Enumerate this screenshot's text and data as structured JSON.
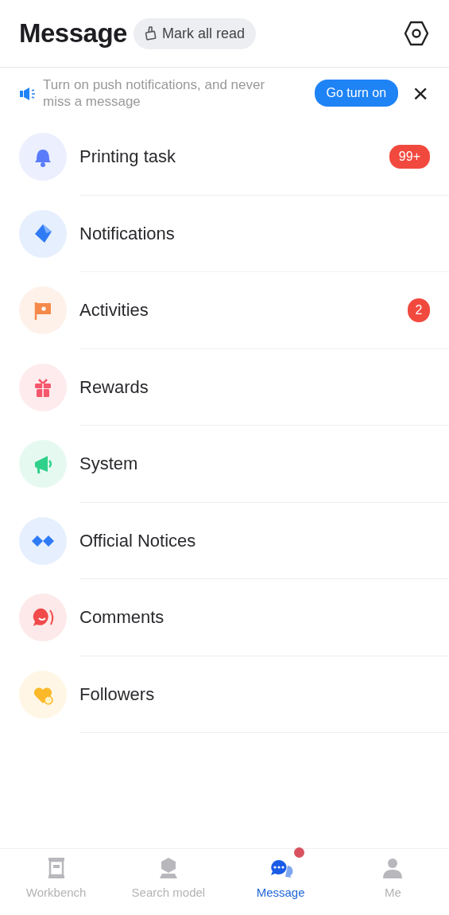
{
  "header": {
    "title": "Message",
    "mark_all_read": "Mark all read"
  },
  "banner": {
    "text": "Turn on push notifications, and never miss a message",
    "button": "Go turn on",
    "close": "×"
  },
  "items": [
    {
      "label": "Printing task",
      "kind": "bell",
      "color": "#5b7cfa",
      "badge": "99+"
    },
    {
      "label": "Notifications",
      "kind": "cube",
      "color": "#2f7bf5"
    },
    {
      "label": "Activities",
      "kind": "flag",
      "color": "#f58a4b",
      "badge": "2"
    },
    {
      "label": "Rewards",
      "kind": "gift",
      "color": "#f5576c"
    },
    {
      "label": "System",
      "kind": "megaphone",
      "color": "#2fd08a"
    },
    {
      "label": "Official Notices",
      "kind": "diamonds",
      "color": "#2f7bf5"
    },
    {
      "label": "Comments",
      "kind": "chat",
      "color": "#f04a4a"
    },
    {
      "label": "Followers",
      "kind": "heart",
      "color": "#fbb829"
    }
  ],
  "tabs": [
    {
      "label": "Workbench",
      "kind": "workbench",
      "selected": false,
      "dot": false
    },
    {
      "label": "Search model",
      "kind": "model",
      "selected": false,
      "dot": false
    },
    {
      "label": "Message",
      "kind": "message",
      "selected": true,
      "dot": true
    },
    {
      "label": "Me",
      "kind": "person",
      "selected": false,
      "dot": false
    }
  ]
}
